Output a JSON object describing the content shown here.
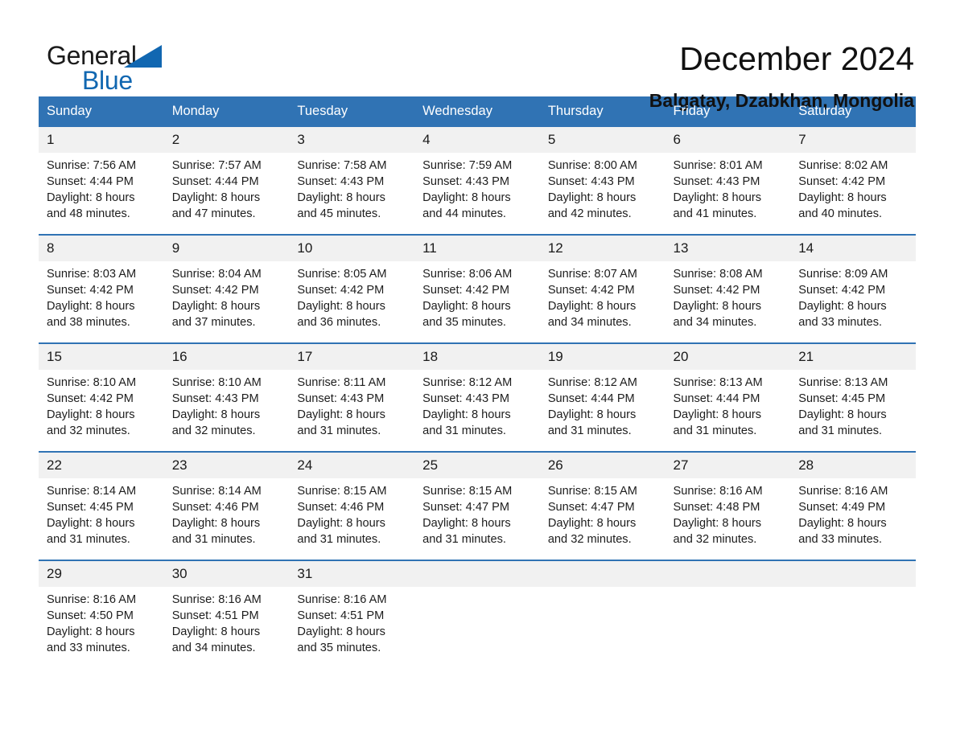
{
  "brand": {
    "name_part1": "General",
    "name_part2": "Blue",
    "triangle_icon": "triangle-icon",
    "accent_color": "#1167b1"
  },
  "header": {
    "title": "December 2024",
    "location": "Balgatay, Dzabkhan, Mongolia"
  },
  "theme": {
    "header_bg": "#3073b4",
    "daynum_bg": "#f1f1f1",
    "row_divider": "#3073b4",
    "page_bg": "#ffffff"
  },
  "calendar": {
    "weekday_headers": [
      "Sunday",
      "Monday",
      "Tuesday",
      "Wednesday",
      "Thursday",
      "Friday",
      "Saturday"
    ],
    "weeks": [
      [
        {
          "day": "1",
          "sunrise": "Sunrise: 7:56 AM",
          "sunset": "Sunset: 4:44 PM",
          "daylight": "Daylight: 8 hours and 48 minutes."
        },
        {
          "day": "2",
          "sunrise": "Sunrise: 7:57 AM",
          "sunset": "Sunset: 4:44 PM",
          "daylight": "Daylight: 8 hours and 47 minutes."
        },
        {
          "day": "3",
          "sunrise": "Sunrise: 7:58 AM",
          "sunset": "Sunset: 4:43 PM",
          "daylight": "Daylight: 8 hours and 45 minutes."
        },
        {
          "day": "4",
          "sunrise": "Sunrise: 7:59 AM",
          "sunset": "Sunset: 4:43 PM",
          "daylight": "Daylight: 8 hours and 44 minutes."
        },
        {
          "day": "5",
          "sunrise": "Sunrise: 8:00 AM",
          "sunset": "Sunset: 4:43 PM",
          "daylight": "Daylight: 8 hours and 42 minutes."
        },
        {
          "day": "6",
          "sunrise": "Sunrise: 8:01 AM",
          "sunset": "Sunset: 4:43 PM",
          "daylight": "Daylight: 8 hours and 41 minutes."
        },
        {
          "day": "7",
          "sunrise": "Sunrise: 8:02 AM",
          "sunset": "Sunset: 4:42 PM",
          "daylight": "Daylight: 8 hours and 40 minutes."
        }
      ],
      [
        {
          "day": "8",
          "sunrise": "Sunrise: 8:03 AM",
          "sunset": "Sunset: 4:42 PM",
          "daylight": "Daylight: 8 hours and 38 minutes."
        },
        {
          "day": "9",
          "sunrise": "Sunrise: 8:04 AM",
          "sunset": "Sunset: 4:42 PM",
          "daylight": "Daylight: 8 hours and 37 minutes."
        },
        {
          "day": "10",
          "sunrise": "Sunrise: 8:05 AM",
          "sunset": "Sunset: 4:42 PM",
          "daylight": "Daylight: 8 hours and 36 minutes."
        },
        {
          "day": "11",
          "sunrise": "Sunrise: 8:06 AM",
          "sunset": "Sunset: 4:42 PM",
          "daylight": "Daylight: 8 hours and 35 minutes."
        },
        {
          "day": "12",
          "sunrise": "Sunrise: 8:07 AM",
          "sunset": "Sunset: 4:42 PM",
          "daylight": "Daylight: 8 hours and 34 minutes."
        },
        {
          "day": "13",
          "sunrise": "Sunrise: 8:08 AM",
          "sunset": "Sunset: 4:42 PM",
          "daylight": "Daylight: 8 hours and 34 minutes."
        },
        {
          "day": "14",
          "sunrise": "Sunrise: 8:09 AM",
          "sunset": "Sunset: 4:42 PM",
          "daylight": "Daylight: 8 hours and 33 minutes."
        }
      ],
      [
        {
          "day": "15",
          "sunrise": "Sunrise: 8:10 AM",
          "sunset": "Sunset: 4:42 PM",
          "daylight": "Daylight: 8 hours and 32 minutes."
        },
        {
          "day": "16",
          "sunrise": "Sunrise: 8:10 AM",
          "sunset": "Sunset: 4:43 PM",
          "daylight": "Daylight: 8 hours and 32 minutes."
        },
        {
          "day": "17",
          "sunrise": "Sunrise: 8:11 AM",
          "sunset": "Sunset: 4:43 PM",
          "daylight": "Daylight: 8 hours and 31 minutes."
        },
        {
          "day": "18",
          "sunrise": "Sunrise: 8:12 AM",
          "sunset": "Sunset: 4:43 PM",
          "daylight": "Daylight: 8 hours and 31 minutes."
        },
        {
          "day": "19",
          "sunrise": "Sunrise: 8:12 AM",
          "sunset": "Sunset: 4:44 PM",
          "daylight": "Daylight: 8 hours and 31 minutes."
        },
        {
          "day": "20",
          "sunrise": "Sunrise: 8:13 AM",
          "sunset": "Sunset: 4:44 PM",
          "daylight": "Daylight: 8 hours and 31 minutes."
        },
        {
          "day": "21",
          "sunrise": "Sunrise: 8:13 AM",
          "sunset": "Sunset: 4:45 PM",
          "daylight": "Daylight: 8 hours and 31 minutes."
        }
      ],
      [
        {
          "day": "22",
          "sunrise": "Sunrise: 8:14 AM",
          "sunset": "Sunset: 4:45 PM",
          "daylight": "Daylight: 8 hours and 31 minutes."
        },
        {
          "day": "23",
          "sunrise": "Sunrise: 8:14 AM",
          "sunset": "Sunset: 4:46 PM",
          "daylight": "Daylight: 8 hours and 31 minutes."
        },
        {
          "day": "24",
          "sunrise": "Sunrise: 8:15 AM",
          "sunset": "Sunset: 4:46 PM",
          "daylight": "Daylight: 8 hours and 31 minutes."
        },
        {
          "day": "25",
          "sunrise": "Sunrise: 8:15 AM",
          "sunset": "Sunset: 4:47 PM",
          "daylight": "Daylight: 8 hours and 31 minutes."
        },
        {
          "day": "26",
          "sunrise": "Sunrise: 8:15 AM",
          "sunset": "Sunset: 4:47 PM",
          "daylight": "Daylight: 8 hours and 32 minutes."
        },
        {
          "day": "27",
          "sunrise": "Sunrise: 8:16 AM",
          "sunset": "Sunset: 4:48 PM",
          "daylight": "Daylight: 8 hours and 32 minutes."
        },
        {
          "day": "28",
          "sunrise": "Sunrise: 8:16 AM",
          "sunset": "Sunset: 4:49 PM",
          "daylight": "Daylight: 8 hours and 33 minutes."
        }
      ],
      [
        {
          "day": "29",
          "sunrise": "Sunrise: 8:16 AM",
          "sunset": "Sunset: 4:50 PM",
          "daylight": "Daylight: 8 hours and 33 minutes."
        },
        {
          "day": "30",
          "sunrise": "Sunrise: 8:16 AM",
          "sunset": "Sunset: 4:51 PM",
          "daylight": "Daylight: 8 hours and 34 minutes."
        },
        {
          "day": "31",
          "sunrise": "Sunrise: 8:16 AM",
          "sunset": "Sunset: 4:51 PM",
          "daylight": "Daylight: 8 hours and 35 minutes."
        },
        {
          "day": "",
          "sunrise": "",
          "sunset": "",
          "daylight": ""
        },
        {
          "day": "",
          "sunrise": "",
          "sunset": "",
          "daylight": ""
        },
        {
          "day": "",
          "sunrise": "",
          "sunset": "",
          "daylight": ""
        },
        {
          "day": "",
          "sunrise": "",
          "sunset": "",
          "daylight": ""
        }
      ]
    ]
  }
}
